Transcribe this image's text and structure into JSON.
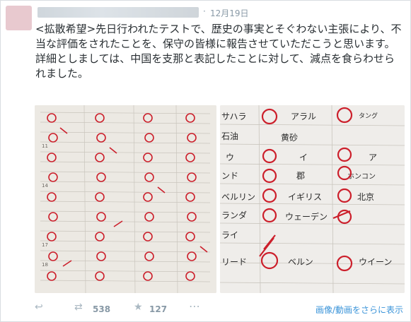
{
  "tweet": {
    "date": "12月19日",
    "text": "<拡散希望>先日行われたテストで、歴史の事実とそぐわない主張により、不当な評価をされたことを、保守の皆様に報告させていただこうと思います。\n詳細としましては、中国を支那と表記したことに対して、減点を食らわせられました。"
  },
  "photo_right_lines": [
    "サハラ",
    "アラル",
    "タング",
    "石油",
    "黄砂",
    "ウ",
    "イ",
    "ア",
    "ンド",
    "郡",
    "ホンコン",
    "ベルリン",
    "イギリス",
    "北京",
    "ランダ",
    "ウェーデン",
    "ライ",
    "リード",
    "ベルン",
    "ウイーン"
  ],
  "actions": {
    "reply_icon": "reply-icon",
    "retweet_icon": "retweet-icon",
    "retweet_count": "538",
    "favorite_icon": "star-icon",
    "favorite_count": "127",
    "media_link": "画像/動画をさらに表示"
  },
  "colors": {
    "link": "#3b94d9",
    "muted": "#8899a6",
    "icon": "#aab8c2",
    "ink_red": "#cc1f2b"
  }
}
